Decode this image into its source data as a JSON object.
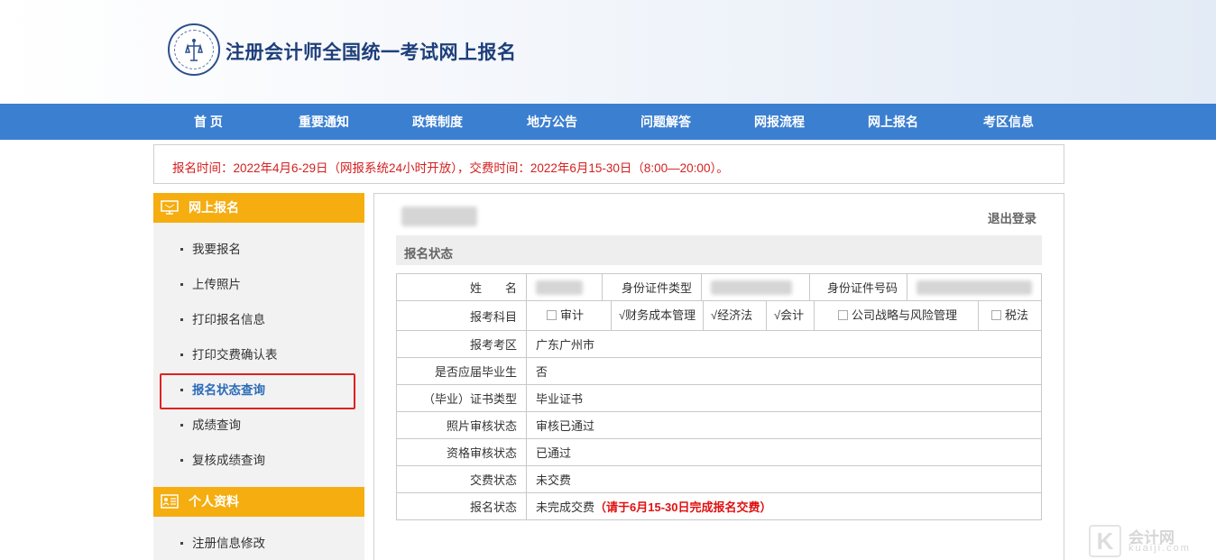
{
  "header": {
    "title": "注册会计师全国统一考试网上报名"
  },
  "nav": [
    "首 页",
    "重要通知",
    "政策制度",
    "地方公告",
    "问题解答",
    "网报流程",
    "网上报名",
    "考区信息"
  ],
  "notice": "报名时间：2022年4月6-29日（网报系统24小时开放），交费时间：2022年6月15-30日（8:00—20:00）。",
  "sidebar": {
    "section1": {
      "title": "网上报名",
      "items": [
        "我要报名",
        "上传照片",
        "打印报名信息",
        "打印交费确认表",
        "报名状态查询",
        "成绩查询",
        "复核成绩查询"
      ],
      "active": "报名状态查询"
    },
    "section2": {
      "title": "个人资料",
      "items": [
        "注册信息修改"
      ]
    }
  },
  "main": {
    "logout": "退出登录",
    "section_title": "报名状态",
    "row_name_label": "姓　　名",
    "id_type_label": "身份证件类型",
    "id_number_label": "身份证件号码",
    "subjects_label": "报考科目",
    "subjects": [
      {
        "name": "审计",
        "selected": false,
        "mark": ""
      },
      {
        "name": "财务成本管理",
        "selected": true,
        "mark": "√"
      },
      {
        "name": "经济法",
        "selected": true,
        "mark": "√"
      },
      {
        "name": "会计",
        "selected": true,
        "mark": "√"
      },
      {
        "name": "公司战略与风险管理",
        "selected": false,
        "mark": ""
      },
      {
        "name": "税法",
        "selected": false,
        "mark": ""
      }
    ],
    "rows": [
      {
        "label": "报考考区",
        "value": "广东广州市"
      },
      {
        "label": "是否应届毕业生",
        "value": "否"
      },
      {
        "label": "（毕业）证书类型",
        "value": "毕业证书"
      },
      {
        "label": "照片审核状态",
        "value": "审核已通过"
      },
      {
        "label": "资格审核状态",
        "value": "已通过"
      },
      {
        "label": "交费状态",
        "value": "未交费"
      },
      {
        "label": "报名状态",
        "value": "未完成交费",
        "note": "（请于6月15-30日完成报名交费）"
      }
    ]
  },
  "watermark": {
    "line1": "会计网",
    "line2": "kuaiji.com",
    "letter": "K"
  }
}
